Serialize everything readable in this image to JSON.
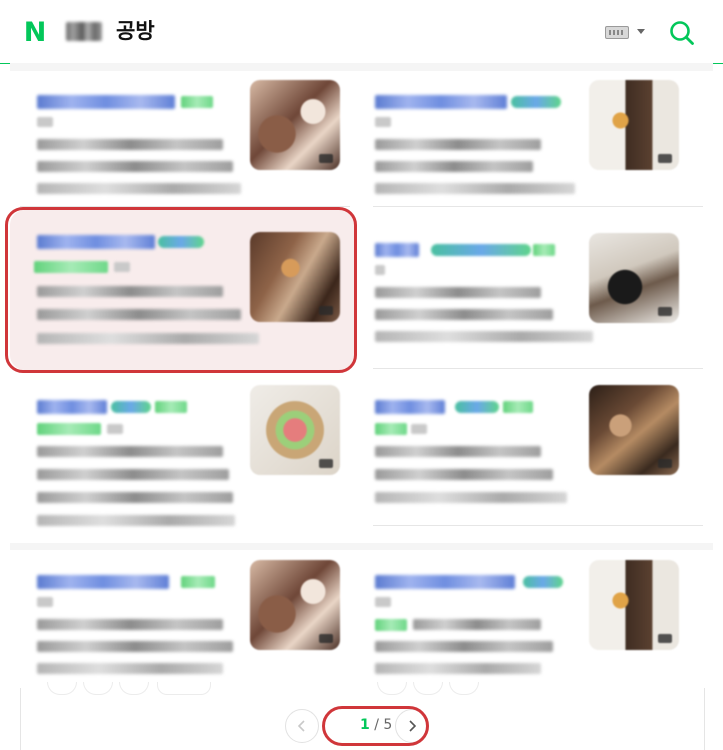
{
  "header": {
    "logo_letter": "N",
    "query_suffix": "공방",
    "icons": [
      "naver-logo-icon",
      "keyboard-icon",
      "chevron-down-icon",
      "search-icon"
    ]
  },
  "colors": {
    "brand_green": "#03c75a",
    "highlight_red": "#d0363a",
    "link_blue": "#5b7bd0",
    "selected_bg": "#f8ecec"
  },
  "pagination": {
    "current": "1",
    "separator": "/",
    "total": "5",
    "icons": [
      "chevron-left-icon",
      "chevron-right-icon"
    ]
  }
}
